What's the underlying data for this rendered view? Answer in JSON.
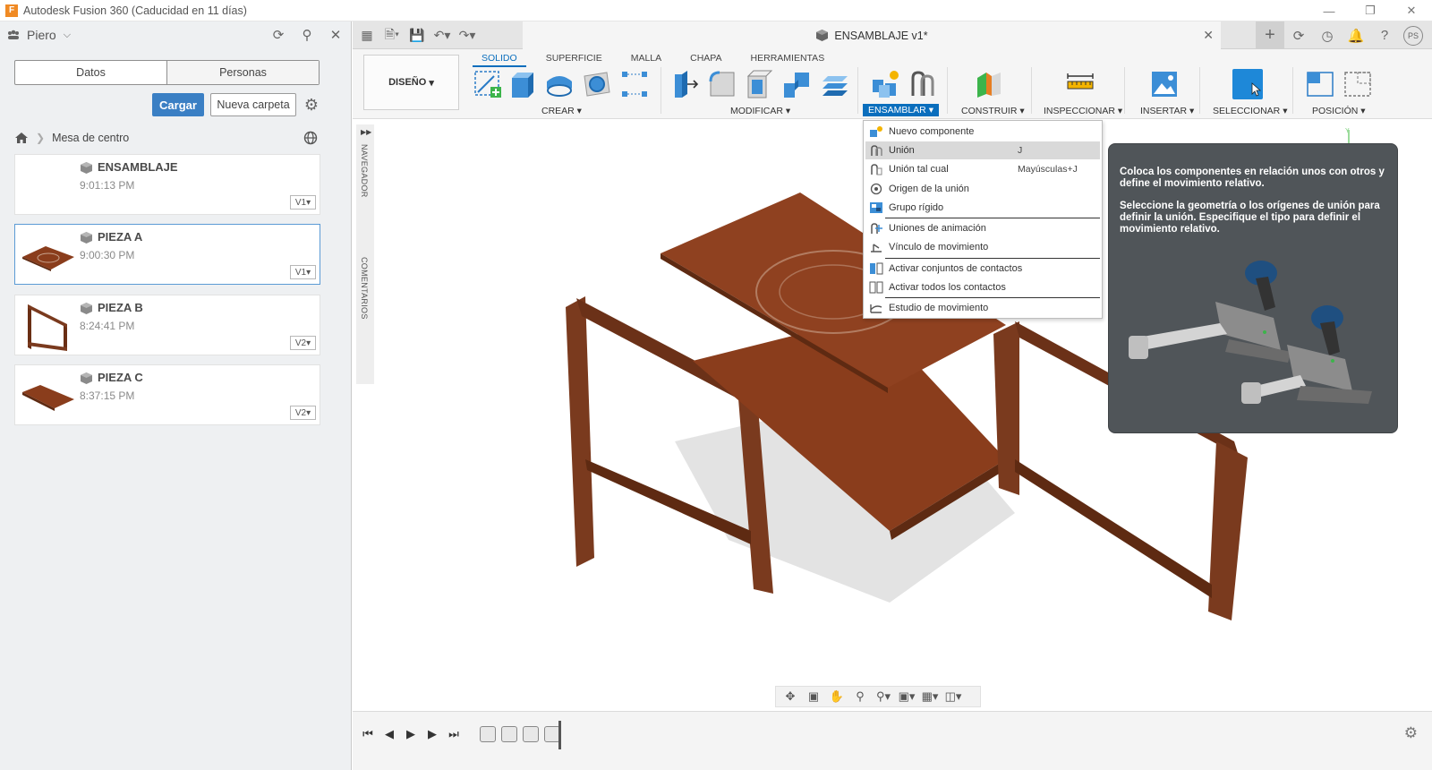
{
  "window": {
    "title": "Autodesk Fusion 360 (Caducidad en 11 días)",
    "logo_letter": "F"
  },
  "data_panel": {
    "user": "Piero",
    "tabs": [
      "Datos",
      "Personas"
    ],
    "upload_label": "Cargar",
    "new_folder_label": "Nueva carpeta",
    "breadcrumb_folder": "Mesa de centro",
    "files": [
      {
        "name": "ENSAMBLAJE",
        "time": "9:01:13 PM",
        "version": "V1"
      },
      {
        "name": "PIEZA A",
        "time": "9:00:30 PM",
        "version": "V1"
      },
      {
        "name": "PIEZA B",
        "time": "8:24:41 PM",
        "version": "V2"
      },
      {
        "name": "PIEZA C",
        "time": "8:37:15 PM",
        "version": "V2"
      }
    ]
  },
  "document": {
    "title": "ENSAMBLAJE v1*",
    "user_initials": "PS"
  },
  "ribbon": {
    "workspace": "DISEÑO",
    "tabs": [
      "SOLIDO",
      "SUPERFICIE",
      "MALLA",
      "CHAPA",
      "HERRAMIENTAS"
    ],
    "groups": [
      "CREAR",
      "MODIFICAR",
      "ENSAMBLAR",
      "CONSTRUIR",
      "INSPECCIONAR",
      "INSERTAR",
      "SELECCIONAR",
      "POSICIÓN"
    ]
  },
  "browser_strip": {
    "navegador": "NAVEGADOR",
    "comentarios": "COMENTARIOS"
  },
  "assemble_menu": {
    "items": [
      {
        "label": "Nuevo componente",
        "shortcut": ""
      },
      {
        "label": "Unión",
        "shortcut": "J"
      },
      {
        "label": "Unión tal cual",
        "shortcut": "Mayúsculas+J"
      },
      {
        "label": "Origen de la unión",
        "shortcut": ""
      },
      {
        "label": "Grupo rígido",
        "shortcut": ""
      },
      {
        "label": "Uniones de animación",
        "shortcut": ""
      },
      {
        "label": "Vínculo de movimiento",
        "shortcut": ""
      },
      {
        "label": "Activar conjuntos de contactos",
        "shortcut": ""
      },
      {
        "label": "Activar todos los contactos",
        "shortcut": ""
      },
      {
        "label": "Estudio de movimiento",
        "shortcut": ""
      }
    ]
  },
  "tooltip": {
    "line1": "Coloca los componentes en relación unos con otros y define el movimiento relativo.",
    "line2": "Seleccione la geometría o los orígenes de unión para definir la unión. Especifique el tipo para definir el movimiento relativo."
  },
  "colors": {
    "accent": "#0a6ebd",
    "upload_button": "#3a7fc4",
    "wood": "#7a3a1e",
    "tooltip_bg": "#505559"
  }
}
